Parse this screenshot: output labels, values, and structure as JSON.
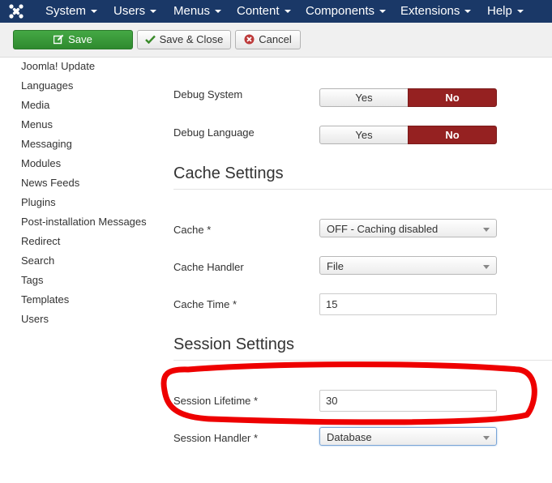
{
  "navbar": {
    "logo_icon": "joomla-logo-icon",
    "items": [
      {
        "label": "System"
      },
      {
        "label": "Users"
      },
      {
        "label": "Menus"
      },
      {
        "label": "Content"
      },
      {
        "label": "Components"
      },
      {
        "label": "Extensions"
      },
      {
        "label": "Help"
      }
    ]
  },
  "toolbar": {
    "save_label": "Save",
    "save_close_label": "Save & Close",
    "cancel_label": "Cancel"
  },
  "sidebar": {
    "items": [
      {
        "label": "Joomla! Update"
      },
      {
        "label": "Languages"
      },
      {
        "label": "Media"
      },
      {
        "label": "Menus"
      },
      {
        "label": "Messaging"
      },
      {
        "label": "Modules"
      },
      {
        "label": "News Feeds"
      },
      {
        "label": "Plugins"
      },
      {
        "label": "Post-installation Messages"
      },
      {
        "label": "Redirect"
      },
      {
        "label": "Search"
      },
      {
        "label": "Tags"
      },
      {
        "label": "Templates"
      },
      {
        "label": "Users"
      }
    ]
  },
  "form": {
    "debug_system": {
      "label": "Debug System",
      "yes": "Yes",
      "no": "No",
      "selected": "No"
    },
    "debug_language": {
      "label": "Debug Language",
      "yes": "Yes",
      "no": "No",
      "selected": "No"
    },
    "cache_heading": "Cache Settings",
    "cache": {
      "label": "Cache *",
      "value": "OFF - Caching disabled"
    },
    "cache_handler": {
      "label": "Cache Handler",
      "value": "File"
    },
    "cache_time": {
      "label": "Cache Time *",
      "value": "15"
    },
    "session_heading": "Session Settings",
    "session_lifetime": {
      "label": "Session Lifetime *",
      "value": "30"
    },
    "session_handler": {
      "label": "Session Handler *",
      "value": "Database"
    }
  },
  "colors": {
    "navbar": "#1a3867",
    "save_button": "#3a9a3a",
    "toggle_no_active": "#952121",
    "annotation": "#ee0000"
  }
}
